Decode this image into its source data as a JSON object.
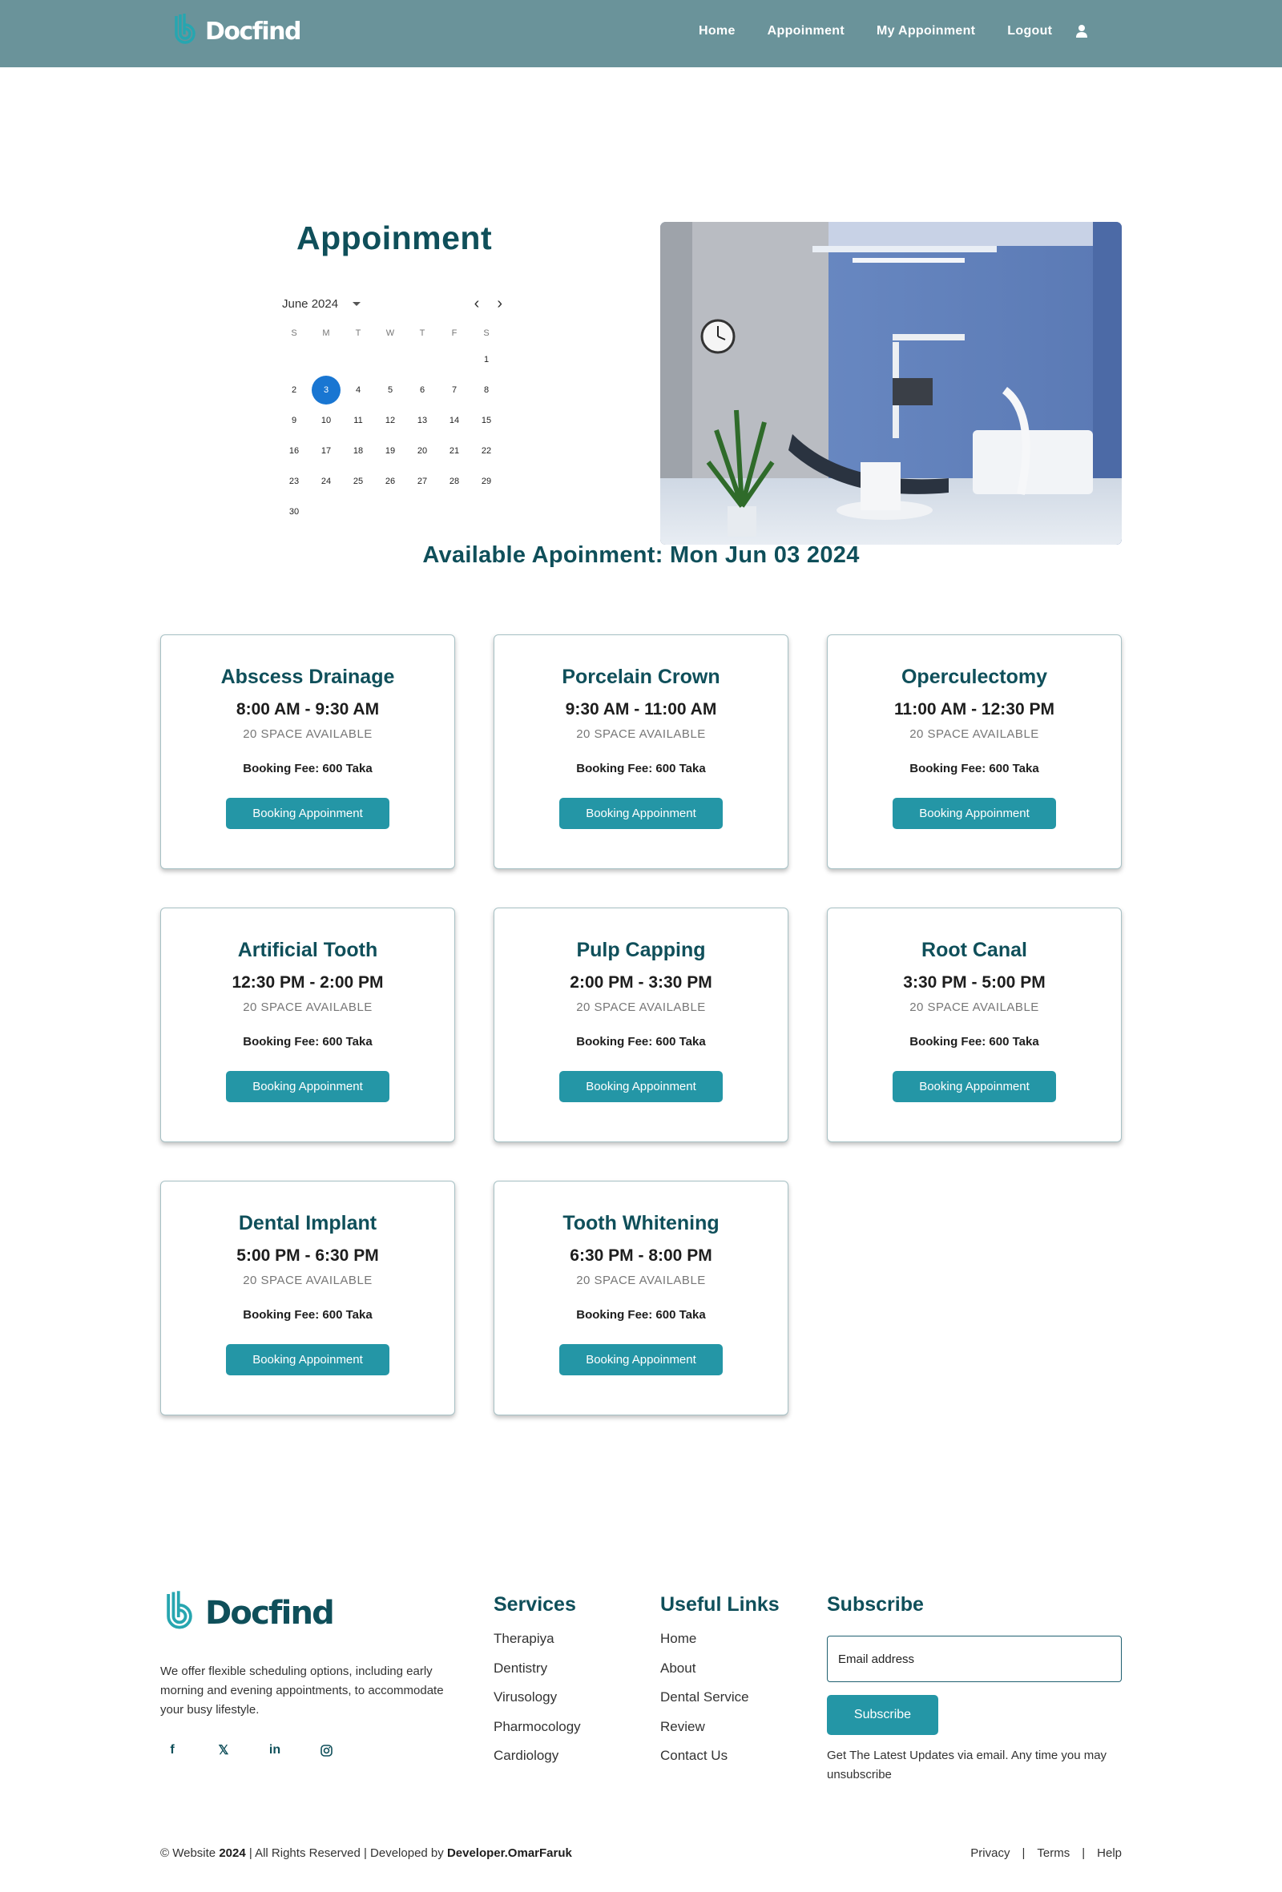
{
  "brand": {
    "name": "Docfind"
  },
  "nav": {
    "home": "Home",
    "appointment": "Appoinment",
    "my_appointment": "My Appoinment",
    "logout": "Logout"
  },
  "hero": {
    "title": "Appoinment",
    "calendar": {
      "month_label": "June 2024",
      "weekdays": [
        "S",
        "M",
        "T",
        "W",
        "T",
        "F",
        "S"
      ],
      "selected_day": 3,
      "days": [
        "",
        "",
        "",
        "",
        "",
        "",
        "1",
        "2",
        "3",
        "4",
        "5",
        "6",
        "7",
        "8",
        "9",
        "10",
        "11",
        "12",
        "13",
        "14",
        "15",
        "16",
        "17",
        "18",
        "19",
        "20",
        "21",
        "22",
        "23",
        "24",
        "25",
        "26",
        "27",
        "28",
        "29",
        "30"
      ]
    }
  },
  "available_heading": "Available Apoinment: Mon Jun 03 2024",
  "cards": [
    {
      "title": "Abscess Drainage",
      "time": "8:00 AM - 9:30 AM",
      "space": "20 SPACE AVAILABLE",
      "fee": "Booking Fee: 600 Taka",
      "button": "Booking Appoinment"
    },
    {
      "title": "Porcelain Crown",
      "time": "9:30 AM - 11:00 AM",
      "space": "20 SPACE AVAILABLE",
      "fee": "Booking Fee: 600 Taka",
      "button": "Booking Appoinment"
    },
    {
      "title": "Operculectomy",
      "time": "11:00 AM - 12:30 PM",
      "space": "20 SPACE AVAILABLE",
      "fee": "Booking Fee: 600 Taka",
      "button": "Booking Appoinment"
    },
    {
      "title": "Artificial Tooth",
      "time": "12:30 PM - 2:00 PM",
      "space": "20 SPACE AVAILABLE",
      "fee": "Booking Fee: 600 Taka",
      "button": "Booking Appoinment"
    },
    {
      "title": "Pulp Capping",
      "time": "2:00 PM - 3:30 PM",
      "space": "20 SPACE AVAILABLE",
      "fee": "Booking Fee: 600 Taka",
      "button": "Booking Appoinment"
    },
    {
      "title": "Root Canal",
      "time": "3:30 PM - 5:00 PM",
      "space": "20 SPACE AVAILABLE",
      "fee": "Booking Fee: 600 Taka",
      "button": "Booking Appoinment"
    },
    {
      "title": "Dental Implant",
      "time": "5:00 PM - 6:30 PM",
      "space": "20 SPACE AVAILABLE",
      "fee": "Booking Fee: 600 Taka",
      "button": "Booking Appoinment"
    },
    {
      "title": "Tooth Whitening",
      "time": "6:30 PM - 8:00 PM",
      "space": "20 SPACE AVAILABLE",
      "fee": "Booking Fee: 600 Taka",
      "button": "Booking Appoinment"
    }
  ],
  "footer": {
    "brand": "Docfind",
    "description": "We offer flexible scheduling options, including early morning and evening appointments, to accommodate your busy lifestyle.",
    "social_icons": [
      "facebook-icon",
      "x-icon",
      "linkedin-icon",
      "instagram-icon"
    ],
    "services": {
      "heading": "Services",
      "items": [
        "Therapiya",
        "Dentistry",
        "Virusology",
        "Pharmocology",
        "Cardiology"
      ]
    },
    "useful_links": {
      "heading": "Useful Links",
      "items": [
        "Home",
        "About",
        "Dental Service",
        "Review",
        "Contact Us"
      ]
    },
    "subscribe": {
      "heading": "Subscribe",
      "placeholder": "Email address",
      "button": "Subscribe",
      "note": "Get The Latest Updates via email. Any time you may unsubscribe"
    },
    "copyright_prefix": "© Website ",
    "copyright_year": "2024",
    "copyright_mid": " | All Rights Reserved | Developed by ",
    "developer": "Developer.OmarFaruk",
    "legal": [
      "Privacy",
      "Terms",
      "Help"
    ]
  },
  "colors": {
    "header": "#6a939a",
    "accent": "#2496a6",
    "heading": "#0f4f5a",
    "selected_day": "#1976d2"
  }
}
